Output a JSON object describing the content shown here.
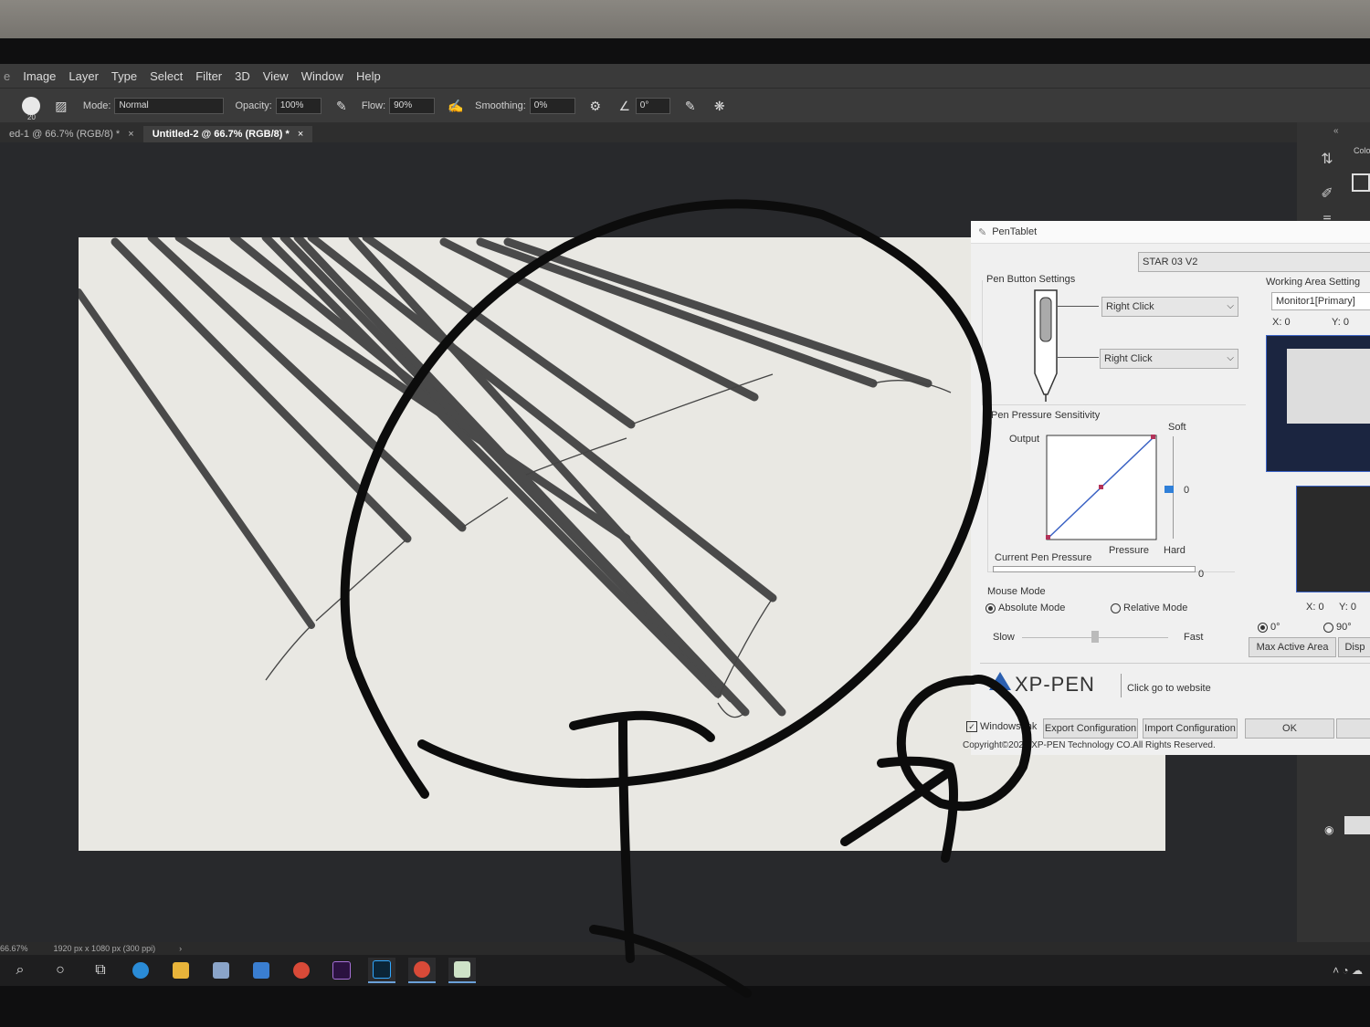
{
  "menubar": {
    "items": [
      "Image",
      "Layer",
      "Type",
      "Select",
      "Filter",
      "3D",
      "View",
      "Window",
      "Help"
    ]
  },
  "options": {
    "mode_label": "Mode:",
    "mode_value": "Normal",
    "opacity_label": "Opacity:",
    "opacity_value": "100%",
    "flow_label": "Flow:",
    "flow_value": "90%",
    "smoothing_label": "Smoothing:",
    "smoothing_value": "0%",
    "angle_value": "0°",
    "brush_size": "20"
  },
  "tabs": [
    {
      "label": "ed-1 @ 66.7% (RGB/8) *",
      "close": "×"
    },
    {
      "label": "Untitled-2 @ 66.7% (RGB/8) *",
      "close": "×"
    }
  ],
  "status": {
    "zoom": "66.67%",
    "doc_info": "1920 px x 1080 px (300 ppi)",
    "arrow": "›"
  },
  "right_panel": {
    "collapse": "«",
    "tab_label": "Colo"
  },
  "dialog": {
    "title": "PenTablet",
    "device": "STAR 03 V2",
    "pen_button_settings": "Pen Button Settings",
    "button1": "Right Click",
    "button2": "Right Click",
    "pressure_sensitivity": "Pen Pressure Sensitivity",
    "output": "Output",
    "soft": "Soft",
    "hard": "Hard",
    "pressure": "Pressure",
    "slider_value": "0",
    "current_pressure": "Current Pen Pressure",
    "current_pressure_value": "0",
    "mouse_mode": "Mouse Mode",
    "absolute_mode": "Absolute Mode",
    "relative_mode": "Relative Mode",
    "slow": "Slow",
    "fast": "Fast",
    "working_area": "Working Area Setting",
    "monitor": "Monitor1[Primary]",
    "x_label": "X: 0",
    "y_label": "Y: 0",
    "x2_label": "X: 0",
    "y2_label": "Y: 0",
    "rot0": "0°",
    "rot90": "90°",
    "max_active_area": "Max Active Area",
    "disp": "Disp",
    "brand": "XP-PEN",
    "website": "Click go to website",
    "windows_ink": "Windows Ink",
    "export": "Export Configuration",
    "import": "Import Configuration",
    "ok": "OK",
    "copyright": "Copyright©2021 XP-PEN Technology CO.All Rights Reserved."
  },
  "colors": {
    "accent_blue": "#3a62c4",
    "pressure_handle": "#2f7fd8",
    "ink": "#0c0c0c"
  }
}
